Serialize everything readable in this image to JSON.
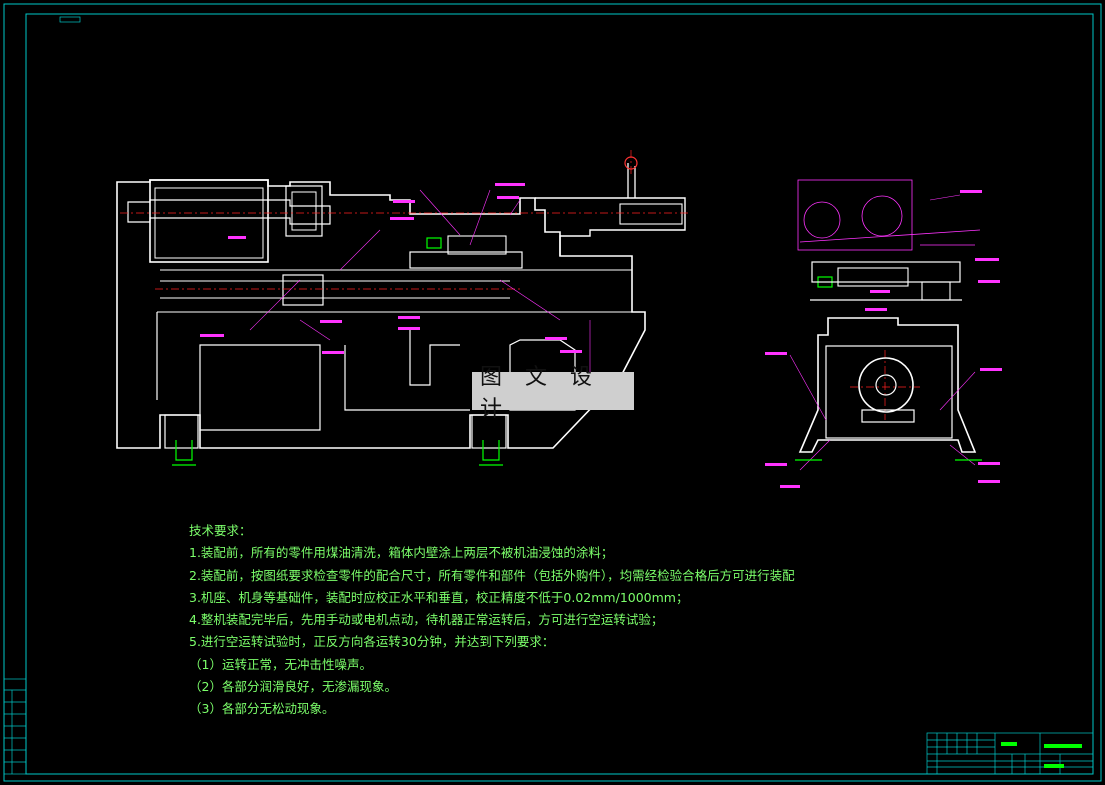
{
  "watermark": {
    "text": "图 文 设 计"
  },
  "technical_requirements": {
    "title": "技术要求：",
    "items": [
      "1.装配前，所有的零件用煤油清洗，箱体内壁涂上两层不被机油浸蚀的涂料；",
      "2.装配前，按图纸要求检查零件的配合尺寸，所有零件和部件（包括外购件），均需经检验合格后方可进行装配",
      "3.机座、机身等基础件，装配时应校正水平和垂直，校正精度不低于0.02mm/1000mm；",
      "4.整机装配完毕后，先用手动或电机点动，待机器正常运转后，方可进行空运转试验；",
      "5.进行空运转试验时，正反方向各运转30分钟，并达到下列要求：",
      "（1）运转正常，无冲击性噪声。",
      "（2）各部分润滑良好，无渗漏现象。",
      "（3）各部分无松动现象。"
    ]
  },
  "colors": {
    "background": "#000000",
    "outline": "#ffffff",
    "frame": "#00c8c8",
    "dimension": "#ff33ff",
    "annotation": "#00ff00",
    "centerline": "#ff2020",
    "notes_text": "#7CFF6B"
  }
}
